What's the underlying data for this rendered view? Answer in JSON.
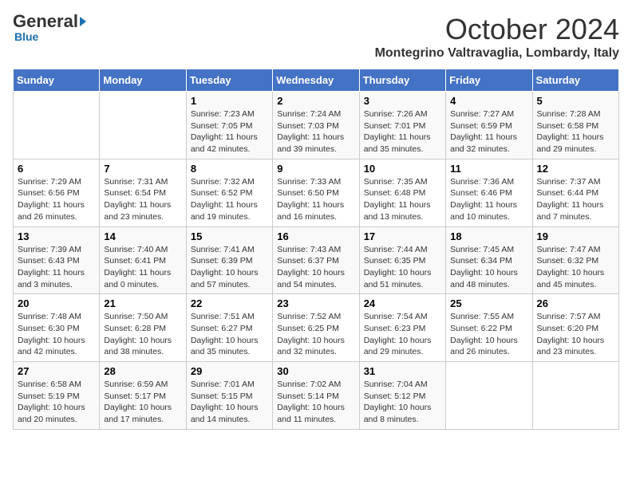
{
  "logo": {
    "general": "General",
    "blue": "Blue"
  },
  "header": {
    "month": "October 2024",
    "location": "Montegrino Valtravaglia, Lombardy, Italy"
  },
  "weekdays": [
    "Sunday",
    "Monday",
    "Tuesday",
    "Wednesday",
    "Thursday",
    "Friday",
    "Saturday"
  ],
  "weeks": [
    [
      null,
      null,
      {
        "day": "1",
        "sunrise": "Sunrise: 7:23 AM",
        "sunset": "Sunset: 7:05 PM",
        "daylight": "Daylight: 11 hours and 42 minutes."
      },
      {
        "day": "2",
        "sunrise": "Sunrise: 7:24 AM",
        "sunset": "Sunset: 7:03 PM",
        "daylight": "Daylight: 11 hours and 39 minutes."
      },
      {
        "day": "3",
        "sunrise": "Sunrise: 7:26 AM",
        "sunset": "Sunset: 7:01 PM",
        "daylight": "Daylight: 11 hours and 35 minutes."
      },
      {
        "day": "4",
        "sunrise": "Sunrise: 7:27 AM",
        "sunset": "Sunset: 6:59 PM",
        "daylight": "Daylight: 11 hours and 32 minutes."
      },
      {
        "day": "5",
        "sunrise": "Sunrise: 7:28 AM",
        "sunset": "Sunset: 6:58 PM",
        "daylight": "Daylight: 11 hours and 29 minutes."
      }
    ],
    [
      {
        "day": "6",
        "sunrise": "Sunrise: 7:29 AM",
        "sunset": "Sunset: 6:56 PM",
        "daylight": "Daylight: 11 hours and 26 minutes."
      },
      {
        "day": "7",
        "sunrise": "Sunrise: 7:31 AM",
        "sunset": "Sunset: 6:54 PM",
        "daylight": "Daylight: 11 hours and 23 minutes."
      },
      {
        "day": "8",
        "sunrise": "Sunrise: 7:32 AM",
        "sunset": "Sunset: 6:52 PM",
        "daylight": "Daylight: 11 hours and 19 minutes."
      },
      {
        "day": "9",
        "sunrise": "Sunrise: 7:33 AM",
        "sunset": "Sunset: 6:50 PM",
        "daylight": "Daylight: 11 hours and 16 minutes."
      },
      {
        "day": "10",
        "sunrise": "Sunrise: 7:35 AM",
        "sunset": "Sunset: 6:48 PM",
        "daylight": "Daylight: 11 hours and 13 minutes."
      },
      {
        "day": "11",
        "sunrise": "Sunrise: 7:36 AM",
        "sunset": "Sunset: 6:46 PM",
        "daylight": "Daylight: 11 hours and 10 minutes."
      },
      {
        "day": "12",
        "sunrise": "Sunrise: 7:37 AM",
        "sunset": "Sunset: 6:44 PM",
        "daylight": "Daylight: 11 hours and 7 minutes."
      }
    ],
    [
      {
        "day": "13",
        "sunrise": "Sunrise: 7:39 AM",
        "sunset": "Sunset: 6:43 PM",
        "daylight": "Daylight: 11 hours and 3 minutes."
      },
      {
        "day": "14",
        "sunrise": "Sunrise: 7:40 AM",
        "sunset": "Sunset: 6:41 PM",
        "daylight": "Daylight: 11 hours and 0 minutes."
      },
      {
        "day": "15",
        "sunrise": "Sunrise: 7:41 AM",
        "sunset": "Sunset: 6:39 PM",
        "daylight": "Daylight: 10 hours and 57 minutes."
      },
      {
        "day": "16",
        "sunrise": "Sunrise: 7:43 AM",
        "sunset": "Sunset: 6:37 PM",
        "daylight": "Daylight: 10 hours and 54 minutes."
      },
      {
        "day": "17",
        "sunrise": "Sunrise: 7:44 AM",
        "sunset": "Sunset: 6:35 PM",
        "daylight": "Daylight: 10 hours and 51 minutes."
      },
      {
        "day": "18",
        "sunrise": "Sunrise: 7:45 AM",
        "sunset": "Sunset: 6:34 PM",
        "daylight": "Daylight: 10 hours and 48 minutes."
      },
      {
        "day": "19",
        "sunrise": "Sunrise: 7:47 AM",
        "sunset": "Sunset: 6:32 PM",
        "daylight": "Daylight: 10 hours and 45 minutes."
      }
    ],
    [
      {
        "day": "20",
        "sunrise": "Sunrise: 7:48 AM",
        "sunset": "Sunset: 6:30 PM",
        "daylight": "Daylight: 10 hours and 42 minutes."
      },
      {
        "day": "21",
        "sunrise": "Sunrise: 7:50 AM",
        "sunset": "Sunset: 6:28 PM",
        "daylight": "Daylight: 10 hours and 38 minutes."
      },
      {
        "day": "22",
        "sunrise": "Sunrise: 7:51 AM",
        "sunset": "Sunset: 6:27 PM",
        "daylight": "Daylight: 10 hours and 35 minutes."
      },
      {
        "day": "23",
        "sunrise": "Sunrise: 7:52 AM",
        "sunset": "Sunset: 6:25 PM",
        "daylight": "Daylight: 10 hours and 32 minutes."
      },
      {
        "day": "24",
        "sunrise": "Sunrise: 7:54 AM",
        "sunset": "Sunset: 6:23 PM",
        "daylight": "Daylight: 10 hours and 29 minutes."
      },
      {
        "day": "25",
        "sunrise": "Sunrise: 7:55 AM",
        "sunset": "Sunset: 6:22 PM",
        "daylight": "Daylight: 10 hours and 26 minutes."
      },
      {
        "day": "26",
        "sunrise": "Sunrise: 7:57 AM",
        "sunset": "Sunset: 6:20 PM",
        "daylight": "Daylight: 10 hours and 23 minutes."
      }
    ],
    [
      {
        "day": "27",
        "sunrise": "Sunrise: 6:58 AM",
        "sunset": "Sunset: 5:19 PM",
        "daylight": "Daylight: 10 hours and 20 minutes."
      },
      {
        "day": "28",
        "sunrise": "Sunrise: 6:59 AM",
        "sunset": "Sunset: 5:17 PM",
        "daylight": "Daylight: 10 hours and 17 minutes."
      },
      {
        "day": "29",
        "sunrise": "Sunrise: 7:01 AM",
        "sunset": "Sunset: 5:15 PM",
        "daylight": "Daylight: 10 hours and 14 minutes."
      },
      {
        "day": "30",
        "sunrise": "Sunrise: 7:02 AM",
        "sunset": "Sunset: 5:14 PM",
        "daylight": "Daylight: 10 hours and 11 minutes."
      },
      {
        "day": "31",
        "sunrise": "Sunrise: 7:04 AM",
        "sunset": "Sunset: 5:12 PM",
        "daylight": "Daylight: 10 hours and 8 minutes."
      },
      null,
      null
    ]
  ]
}
